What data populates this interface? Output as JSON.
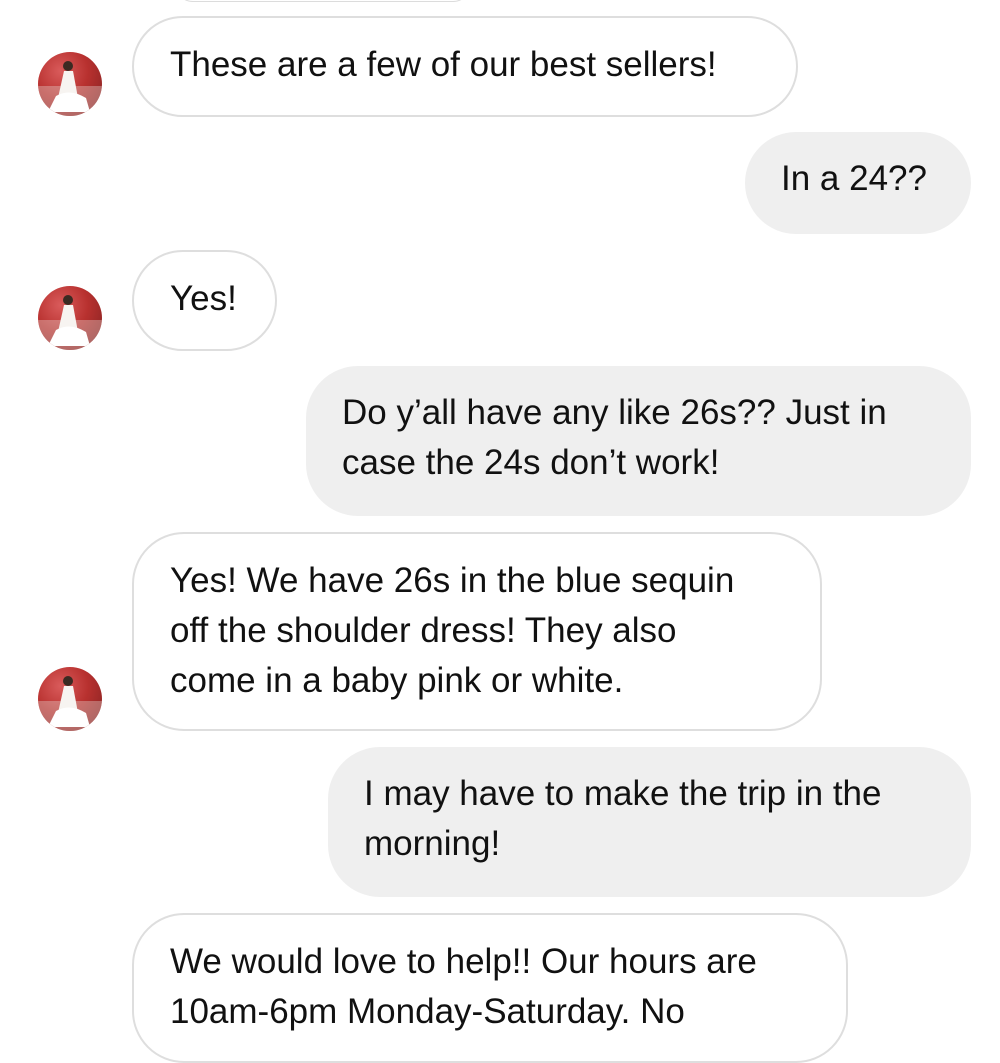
{
  "messages": [
    {
      "sender": "them",
      "text": "These are a few of our best sellers!"
    },
    {
      "sender": "me",
      "text": "In a 24??"
    },
    {
      "sender": "them",
      "text": "Yes!"
    },
    {
      "sender": "me",
      "lines": [
        "Do y’all have any like 26s?? Just in",
        "case the 24s don’t work!"
      ]
    },
    {
      "sender": "them",
      "lines": [
        "Yes! We have 26s in the blue sequin",
        "off the shoulder dress! They also",
        "come in a baby pink or white."
      ]
    },
    {
      "sender": "me",
      "lines": [
        "I may have to make the trip in the",
        "morning!"
      ]
    },
    {
      "sender": "them",
      "lines": [
        "We would love to help!! Our hours are",
        "10am-6pm Monday-Saturday. No"
      ]
    }
  ],
  "icons": {
    "avatar": "profile-photo-avatar"
  },
  "colors": {
    "incoming_bubble_bg": "#ffffff",
    "incoming_bubble_border": "#dedede",
    "outgoing_bubble_bg": "#efefef",
    "text": "#111111"
  }
}
